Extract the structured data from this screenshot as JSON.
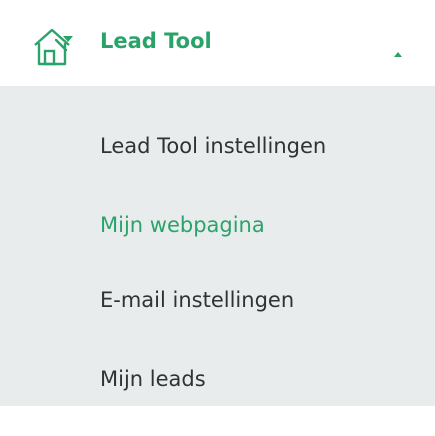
{
  "menu": {
    "header": {
      "label": "Lead Tool",
      "icon": "house-with-tool-icon",
      "expanded": true,
      "caret_icon": "caret-up-icon"
    },
    "items": [
      {
        "label": "Lead Tool instellingen",
        "active": false
      },
      {
        "label": "Mijn webpagina",
        "active": true
      },
      {
        "label": "E-mail instellingen",
        "active": false
      },
      {
        "label": "Mijn leads",
        "active": false
      }
    ]
  },
  "colors": {
    "accent": "#2aa36b",
    "text": "#2e3333",
    "submenu_background": "#e9ecec",
    "header_background": "#ffffff"
  }
}
